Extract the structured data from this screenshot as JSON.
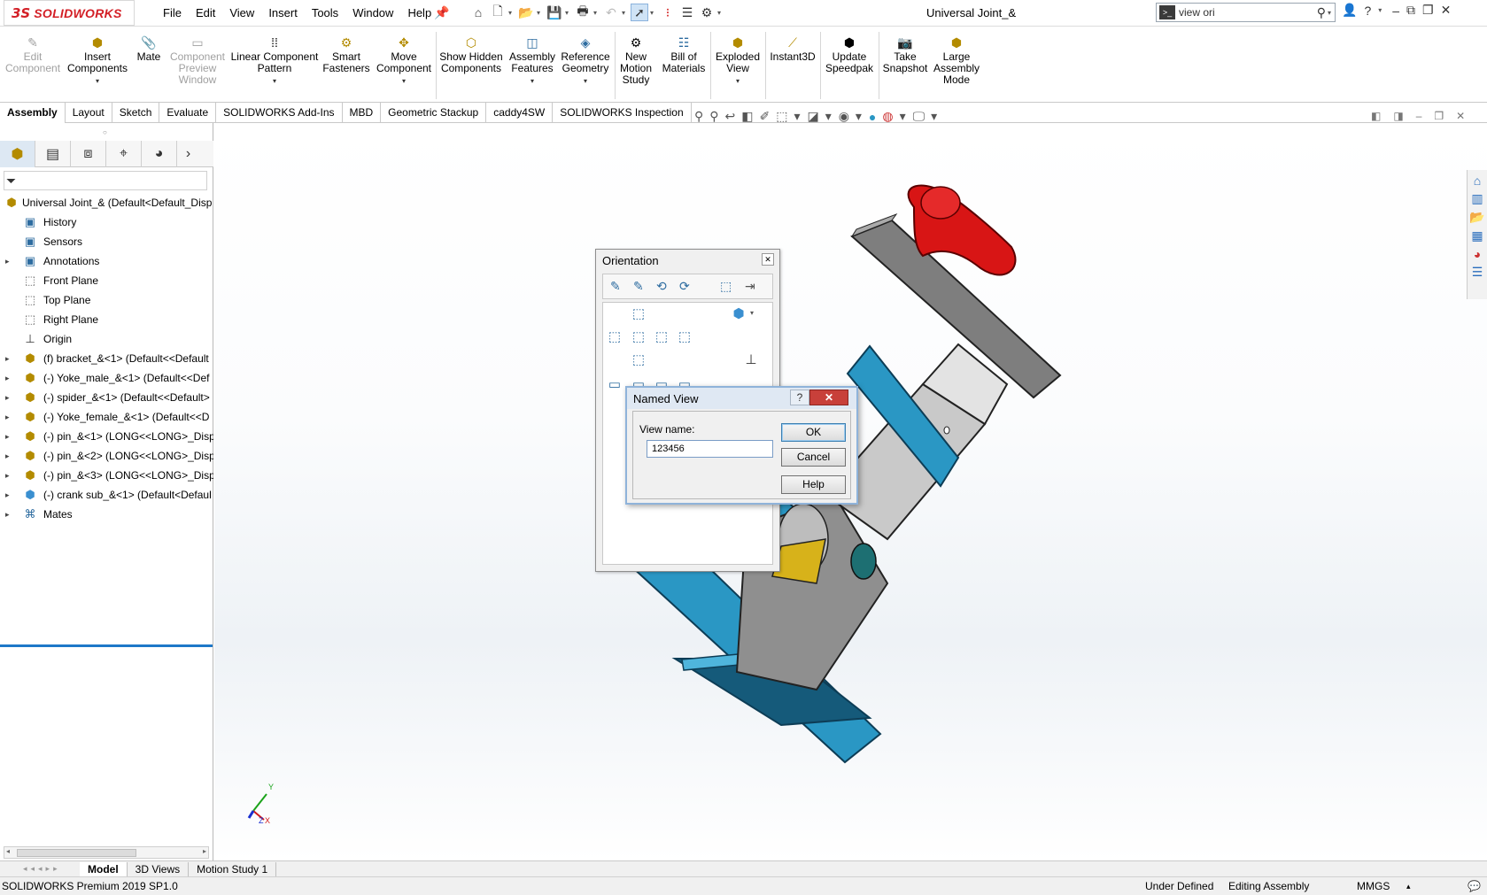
{
  "app": {
    "brand_ds": "3S",
    "brand_name": "SOLIDWORKS",
    "document_title": "Universal Joint_&"
  },
  "menu": [
    "File",
    "Edit",
    "View",
    "Insert",
    "Tools",
    "Window",
    "Help"
  ],
  "search": {
    "value": "view ori"
  },
  "command_manager": [
    {
      "label": "Edit Component",
      "enabled": false,
      "icon": "edit-component-icon"
    },
    {
      "label": "Insert Components",
      "enabled": true,
      "icon": "insert-components-icon",
      "dropdown": true
    },
    {
      "label": "Mate",
      "enabled": true,
      "icon": "mate-icon"
    },
    {
      "label": "Component Preview Window",
      "enabled": false,
      "icon": "preview-window-icon"
    },
    {
      "label": "Linear Component Pattern",
      "enabled": true,
      "icon": "linear-pattern-icon",
      "dropdown": true
    },
    {
      "label": "Smart Fasteners",
      "enabled": true,
      "icon": "smart-fasteners-icon"
    },
    {
      "label": "Move Component",
      "enabled": true,
      "icon": "move-component-icon",
      "dropdown": true
    },
    {
      "label": "Show Hidden Components",
      "enabled": true,
      "icon": "show-hidden-icon"
    },
    {
      "label": "Assembly Features",
      "enabled": true,
      "icon": "assembly-features-icon",
      "dropdown": true
    },
    {
      "label": "Reference Geometry",
      "enabled": true,
      "icon": "reference-geometry-icon",
      "dropdown": true
    },
    {
      "label": "New Motion Study",
      "enabled": true,
      "icon": "motion-study-icon"
    },
    {
      "label": "Bill of Materials",
      "enabled": true,
      "icon": "bill-of-materials-icon"
    },
    {
      "label": "Exploded View",
      "enabled": true,
      "icon": "exploded-view-icon",
      "dropdown": true
    },
    {
      "label": "Instant3D",
      "enabled": true,
      "icon": "instant3d-icon"
    },
    {
      "label": "Update Speedpak",
      "enabled": true,
      "icon": "speedpak-icon"
    },
    {
      "label": "Take Snapshot",
      "enabled": true,
      "icon": "camera-icon"
    },
    {
      "label": "Large Assembly Mode",
      "enabled": true,
      "icon": "large-assembly-icon"
    }
  ],
  "tabs": [
    "Assembly",
    "Layout",
    "Sketch",
    "Evaluate",
    "SOLIDWORKS Add-Ins",
    "MBD",
    "Geometric Stackup",
    "caddy4SW",
    "SOLIDWORKS Inspection"
  ],
  "active_tab": "Assembly",
  "feature_tree": {
    "root": "Universal Joint_& (Default<Default_Disp",
    "items": [
      {
        "label": "History",
        "icon": "history-icon",
        "expandable": false,
        "kind": "folder"
      },
      {
        "label": "Sensors",
        "icon": "sensors-icon",
        "expandable": false,
        "kind": "folder"
      },
      {
        "label": "Annotations",
        "icon": "annotations-icon",
        "expandable": true,
        "kind": "folder"
      },
      {
        "label": "Front Plane",
        "icon": "plane-icon",
        "expandable": false,
        "kind": "plane"
      },
      {
        "label": "Top Plane",
        "icon": "plane-icon",
        "expandable": false,
        "kind": "plane"
      },
      {
        "label": "Right Plane",
        "icon": "plane-icon",
        "expandable": false,
        "kind": "plane"
      },
      {
        "label": "Origin",
        "icon": "origin-icon",
        "expandable": false,
        "kind": "origin"
      },
      {
        "label": "(f) bracket_&<1> (Default<<Default",
        "icon": "part-icon",
        "expandable": true,
        "kind": "part"
      },
      {
        "label": "(-) Yoke_male_&<1> (Default<<Def",
        "icon": "part-icon",
        "expandable": true,
        "kind": "part"
      },
      {
        "label": "(-) spider_&<1> (Default<<Default>",
        "icon": "part-icon",
        "expandable": true,
        "kind": "part"
      },
      {
        "label": "(-) Yoke_female_&<1> (Default<<D",
        "icon": "part-icon",
        "expandable": true,
        "kind": "part"
      },
      {
        "label": "(-) pin_&<1> (LONG<<LONG>_Disp",
        "icon": "part-icon",
        "expandable": true,
        "kind": "part"
      },
      {
        "label": "(-) pin_&<2> (LONG<<LONG>_Disp",
        "icon": "part-icon",
        "expandable": true,
        "kind": "part"
      },
      {
        "label": "(-) pin_&<3> (LONG<<LONG>_Disp",
        "icon": "part-icon",
        "expandable": true,
        "kind": "part"
      },
      {
        "label": "(-) crank sub_&<1> (Default<Defaul",
        "icon": "subassembly-icon",
        "expandable": true,
        "kind": "sub"
      },
      {
        "label": "Mates",
        "icon": "mates-icon",
        "expandable": true,
        "kind": "mates"
      }
    ]
  },
  "orientation_dialog": {
    "title": "Orientation"
  },
  "named_view_dialog": {
    "title": "Named View",
    "field_label": "View name:",
    "field_value": "123456",
    "ok": "OK",
    "cancel": "Cancel",
    "help": "Help",
    "help_glyph": "?",
    "close_glyph": "✕"
  },
  "triad": {
    "y": "Y",
    "x": "X",
    "z": "Z"
  },
  "bottom_tabs": [
    "Model",
    "3D Views",
    "Motion Study 1"
  ],
  "active_bottom_tab": "Model",
  "status": {
    "version": "SOLIDWORKS Premium 2019 SP1.0",
    "state": "Under Defined",
    "mode": "Editing Assembly",
    "units": "MMGS"
  },
  "colors": {
    "brand_red": "#d31f26",
    "bracket_blue": "#2a97c4",
    "knob_red": "#d81515",
    "selection_blue": "#1e78c8"
  }
}
